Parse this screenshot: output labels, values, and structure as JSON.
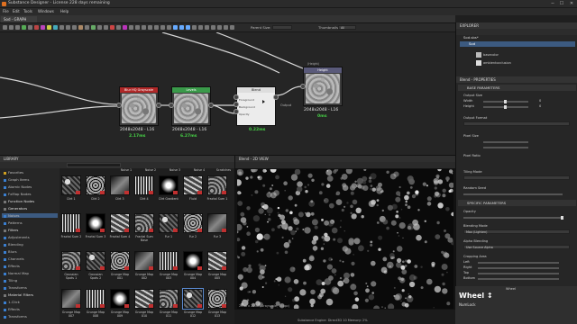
{
  "window": {
    "title": "Substance Designer - License 228 days remaining",
    "minimize": "─",
    "maximize": "☐",
    "close": "✕"
  },
  "menu": [
    "File",
    "Edit",
    "Tools",
    "Windows",
    "Help"
  ],
  "graph_tab": {
    "label": "Sod - GRAPH",
    "parent_size_label": "Parent Size:",
    "thumbnails_label": "Thumbnails:",
    "thumbnails_value": "All"
  },
  "nodes": [
    {
      "header": "Blur HQ Grayscale",
      "header_color": "#b02828",
      "size": "2048x2048 - L16",
      "time": "2.17ms"
    },
    {
      "header": "Levels",
      "header_color": "#3a9a4a",
      "size": "2048x2048 - L16",
      "time": "6.27ms"
    },
    {
      "header": "Blend",
      "header_color": "#dddddd",
      "size": "2048x2048 - L16",
      "time": "0.22ms",
      "inputs": [
        "Foreground",
        "Background",
        "Opacity"
      ],
      "output": "Output"
    },
    {
      "header": "Height",
      "header_color": "#5a5a7a",
      "above": "(Height)",
      "size": "2048x2048 - L16",
      "time": "0ms"
    }
  ],
  "library": {
    "title": "LIBRARY",
    "tree": [
      {
        "label": "Favorites",
        "color": "#d0a020"
      },
      {
        "label": "Graph Items",
        "color": "#3a7fd0"
      },
      {
        "label": "Atomic Nodes",
        "color": "#3a7fd0"
      },
      {
        "label": "FxMap Nodes",
        "color": "#3a7fd0"
      },
      {
        "label": "Function Nodes",
        "color": "#777",
        "category": true
      },
      {
        "label": "Generators",
        "color": "#777",
        "category": true
      },
      {
        "label": "Noises",
        "color": "#3a7fd0",
        "selected": true
      },
      {
        "label": "Patterns",
        "color": "#3a7fd0"
      },
      {
        "label": "Filters",
        "color": "#777",
        "category": true
      },
      {
        "label": "Adjustments",
        "color": "#3a7fd0"
      },
      {
        "label": "Blending",
        "color": "#3a7fd0"
      },
      {
        "label": "Blurs",
        "color": "#3a7fd0"
      },
      {
        "label": "Channels",
        "color": "#3a7fd0"
      },
      {
        "label": "Effects",
        "color": "#3a7fd0"
      },
      {
        "label": "Normal Map",
        "color": "#3a7fd0"
      },
      {
        "label": "Tiling",
        "color": "#3a7fd0"
      },
      {
        "label": "Transforms",
        "color": "#3a7fd0"
      },
      {
        "label": "Material Filters",
        "color": "#777",
        "category": true
      },
      {
        "label": "1-Click",
        "color": "#3a7fd0"
      },
      {
        "label": "Effects",
        "color": "#3a7fd0"
      },
      {
        "label": "Transforms",
        "color": "#3a7fd0"
      }
    ],
    "header_row": [
      "Noise 1",
      "Noise 2",
      "Noise 3",
      "Noise 4",
      "Scratches"
    ],
    "thumbs": [
      [
        "Dirt 1",
        "Dirt 2",
        "Dirt 3",
        "Dirt 4",
        "Dirt Gradient",
        "Fluid",
        "Fractal Sum 1"
      ],
      [
        "Fractal Sum 2",
        "Fractal Sum 3",
        "Fractal Sum 4",
        "Fractal Sum Base",
        "Fur 1",
        "Fur 2",
        "Fur 3"
      ],
      [
        "Gaussian Spots 1",
        "Gaussian Spots 2",
        "Grunge Map 001",
        "Grunge Map 002",
        "Grunge Map 003",
        "Grunge Map 004",
        "Grunge Map 005"
      ],
      [
        "Grunge Map 007",
        "Grunge Map 008",
        "Grunge Map 009",
        "Grunge Map 010",
        "Grunge Map 011",
        "Grunge Map 012",
        "Grunge Map 013"
      ]
    ]
  },
  "view2d": {
    "title": "Blend - 2D VIEW",
    "status": "2048 x 2048 (Grayscale, 16bpc)"
  },
  "explorer": {
    "title": "EXPLORER",
    "package": "Sod.sbs*",
    "graph": "Sod",
    "items": [
      "basecolor",
      "ambientocclusion"
    ]
  },
  "props": {
    "title": "Blend - PROPERTIES",
    "base_section": "BASE PARAMETERS",
    "output_size": "Output Size",
    "width": "Width",
    "height": "Height",
    "width_value": "0",
    "height_value": "0",
    "relative_to_parent": "Relative to parent",
    "output_format": "Output Format",
    "pixel_size": "Pixel Size",
    "pixel_ratio": "Pixel Ratio",
    "tiling_mode": "Tiling Mode",
    "random_seed": "Random Seed",
    "specific_section": "SPECIFIC PARAMETERS",
    "opacity": "Opacity",
    "blending_mode": "Blending Mode",
    "blending_mode_value": "Max (Lighten)",
    "alpha_blending": "Alpha Blending",
    "alpha_blending_value": "Use Source Alpha",
    "cropping_area": "Cropping Area",
    "left": "Left",
    "right": "Right",
    "top": "Top",
    "bottom": "Bottom"
  },
  "wheel": {
    "label": "Wheel ↕",
    "num_lock": "NumLock",
    "wheel_sub": "Wheel"
  },
  "statusbar": "Substance Engine: Direct3D 10   Memory: 2%"
}
